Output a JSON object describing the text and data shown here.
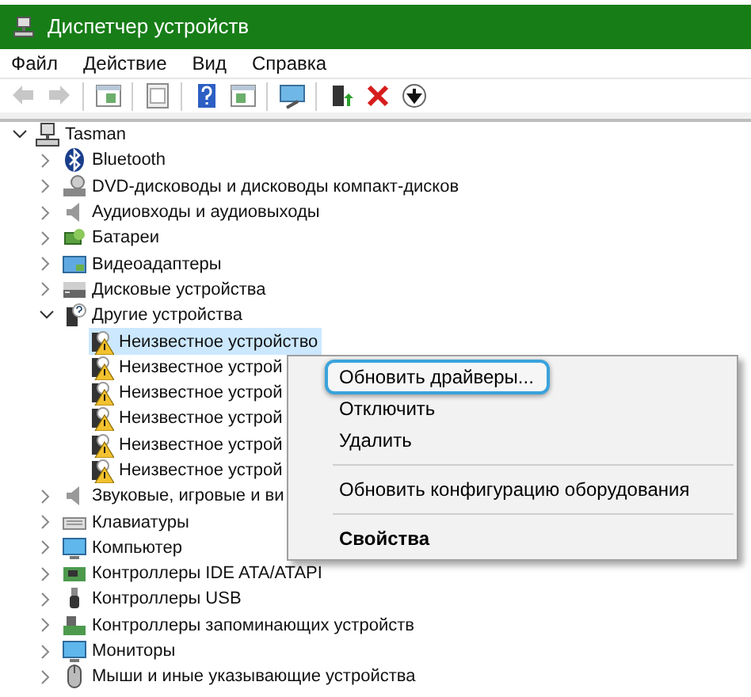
{
  "window": {
    "title": "Диспетчер устройств"
  },
  "menu_bar": [
    "Файл",
    "Действие",
    "Вид",
    "Справка"
  ],
  "toolbar": [
    {
      "disabled": true
    },
    {
      "disabled": true
    },
    {
      "disabled": false
    },
    {
      "disabled": false
    },
    {
      "disabled": false
    },
    {
      "disabled": false
    },
    {
      "disabled": false
    },
    {
      "disabled": false
    },
    {
      "disabled": false
    },
    {
      "disabled": false
    }
  ],
  "tree": [
    {
      "label": "Tasman",
      "expanded": true,
      "selected": false,
      "children": [
        {
          "label": "Bluetooth",
          "expanded": false,
          "selected": false
        },
        {
          "label": "DVD-дисководы и дисководы компакт-дисков",
          "expanded": false,
          "selected": false
        },
        {
          "label": "Аудиовходы и аудиовыходы",
          "expanded": false,
          "selected": false
        },
        {
          "label": "Батареи",
          "expanded": false,
          "selected": false
        },
        {
          "label": "Видеоадаптеры",
          "expanded": false,
          "selected": false
        },
        {
          "label": "Дисковые устройства",
          "expanded": false,
          "selected": false
        },
        {
          "label": "Другие устройства",
          "expanded": true,
          "selected": false,
          "children": [
            {
              "label": "Неизвестное устройство",
              "selected": true
            },
            {
              "label": "Неизвестное устрой",
              "selected": false
            },
            {
              "label": "Неизвестное устрой",
              "selected": false
            },
            {
              "label": "Неизвестное устрой",
              "selected": false
            },
            {
              "label": "Неизвестное устрой",
              "selected": false
            },
            {
              "label": "Неизвестное устрой",
              "selected": false
            }
          ]
        },
        {
          "label": "Звуковые, игровые и ви",
          "expanded": false,
          "selected": false
        },
        {
          "label": "Клавиатуры",
          "expanded": false,
          "selected": false
        },
        {
          "label": "Компьютер",
          "expanded": false,
          "selected": false
        },
        {
          "label": "Контроллеры IDE ATA/ATAPI",
          "expanded": false,
          "selected": false
        },
        {
          "label": "Контроллеры USB",
          "expanded": false,
          "selected": false
        },
        {
          "label": "Контроллеры запоминающих устройств",
          "expanded": false,
          "selected": false
        },
        {
          "label": "Мониторы",
          "expanded": false,
          "selected": false
        },
        {
          "label": "Мыши и иные указывающие устройства",
          "expanded": false,
          "selected": false
        }
      ]
    }
  ],
  "context_menu": [
    {
      "kind": "item",
      "label": "Обновить драйверы...",
      "highlighted": true
    },
    {
      "kind": "item",
      "label": "Отключить",
      "highlighted": false
    },
    {
      "kind": "item",
      "label": "Удалить",
      "highlighted": false
    },
    {
      "kind": "separator"
    },
    {
      "kind": "item",
      "label": "Обновить конфигурацию оборудования",
      "highlighted": false
    },
    {
      "kind": "separator"
    },
    {
      "kind": "default",
      "label": "Свойства",
      "highlighted": false
    }
  ]
}
